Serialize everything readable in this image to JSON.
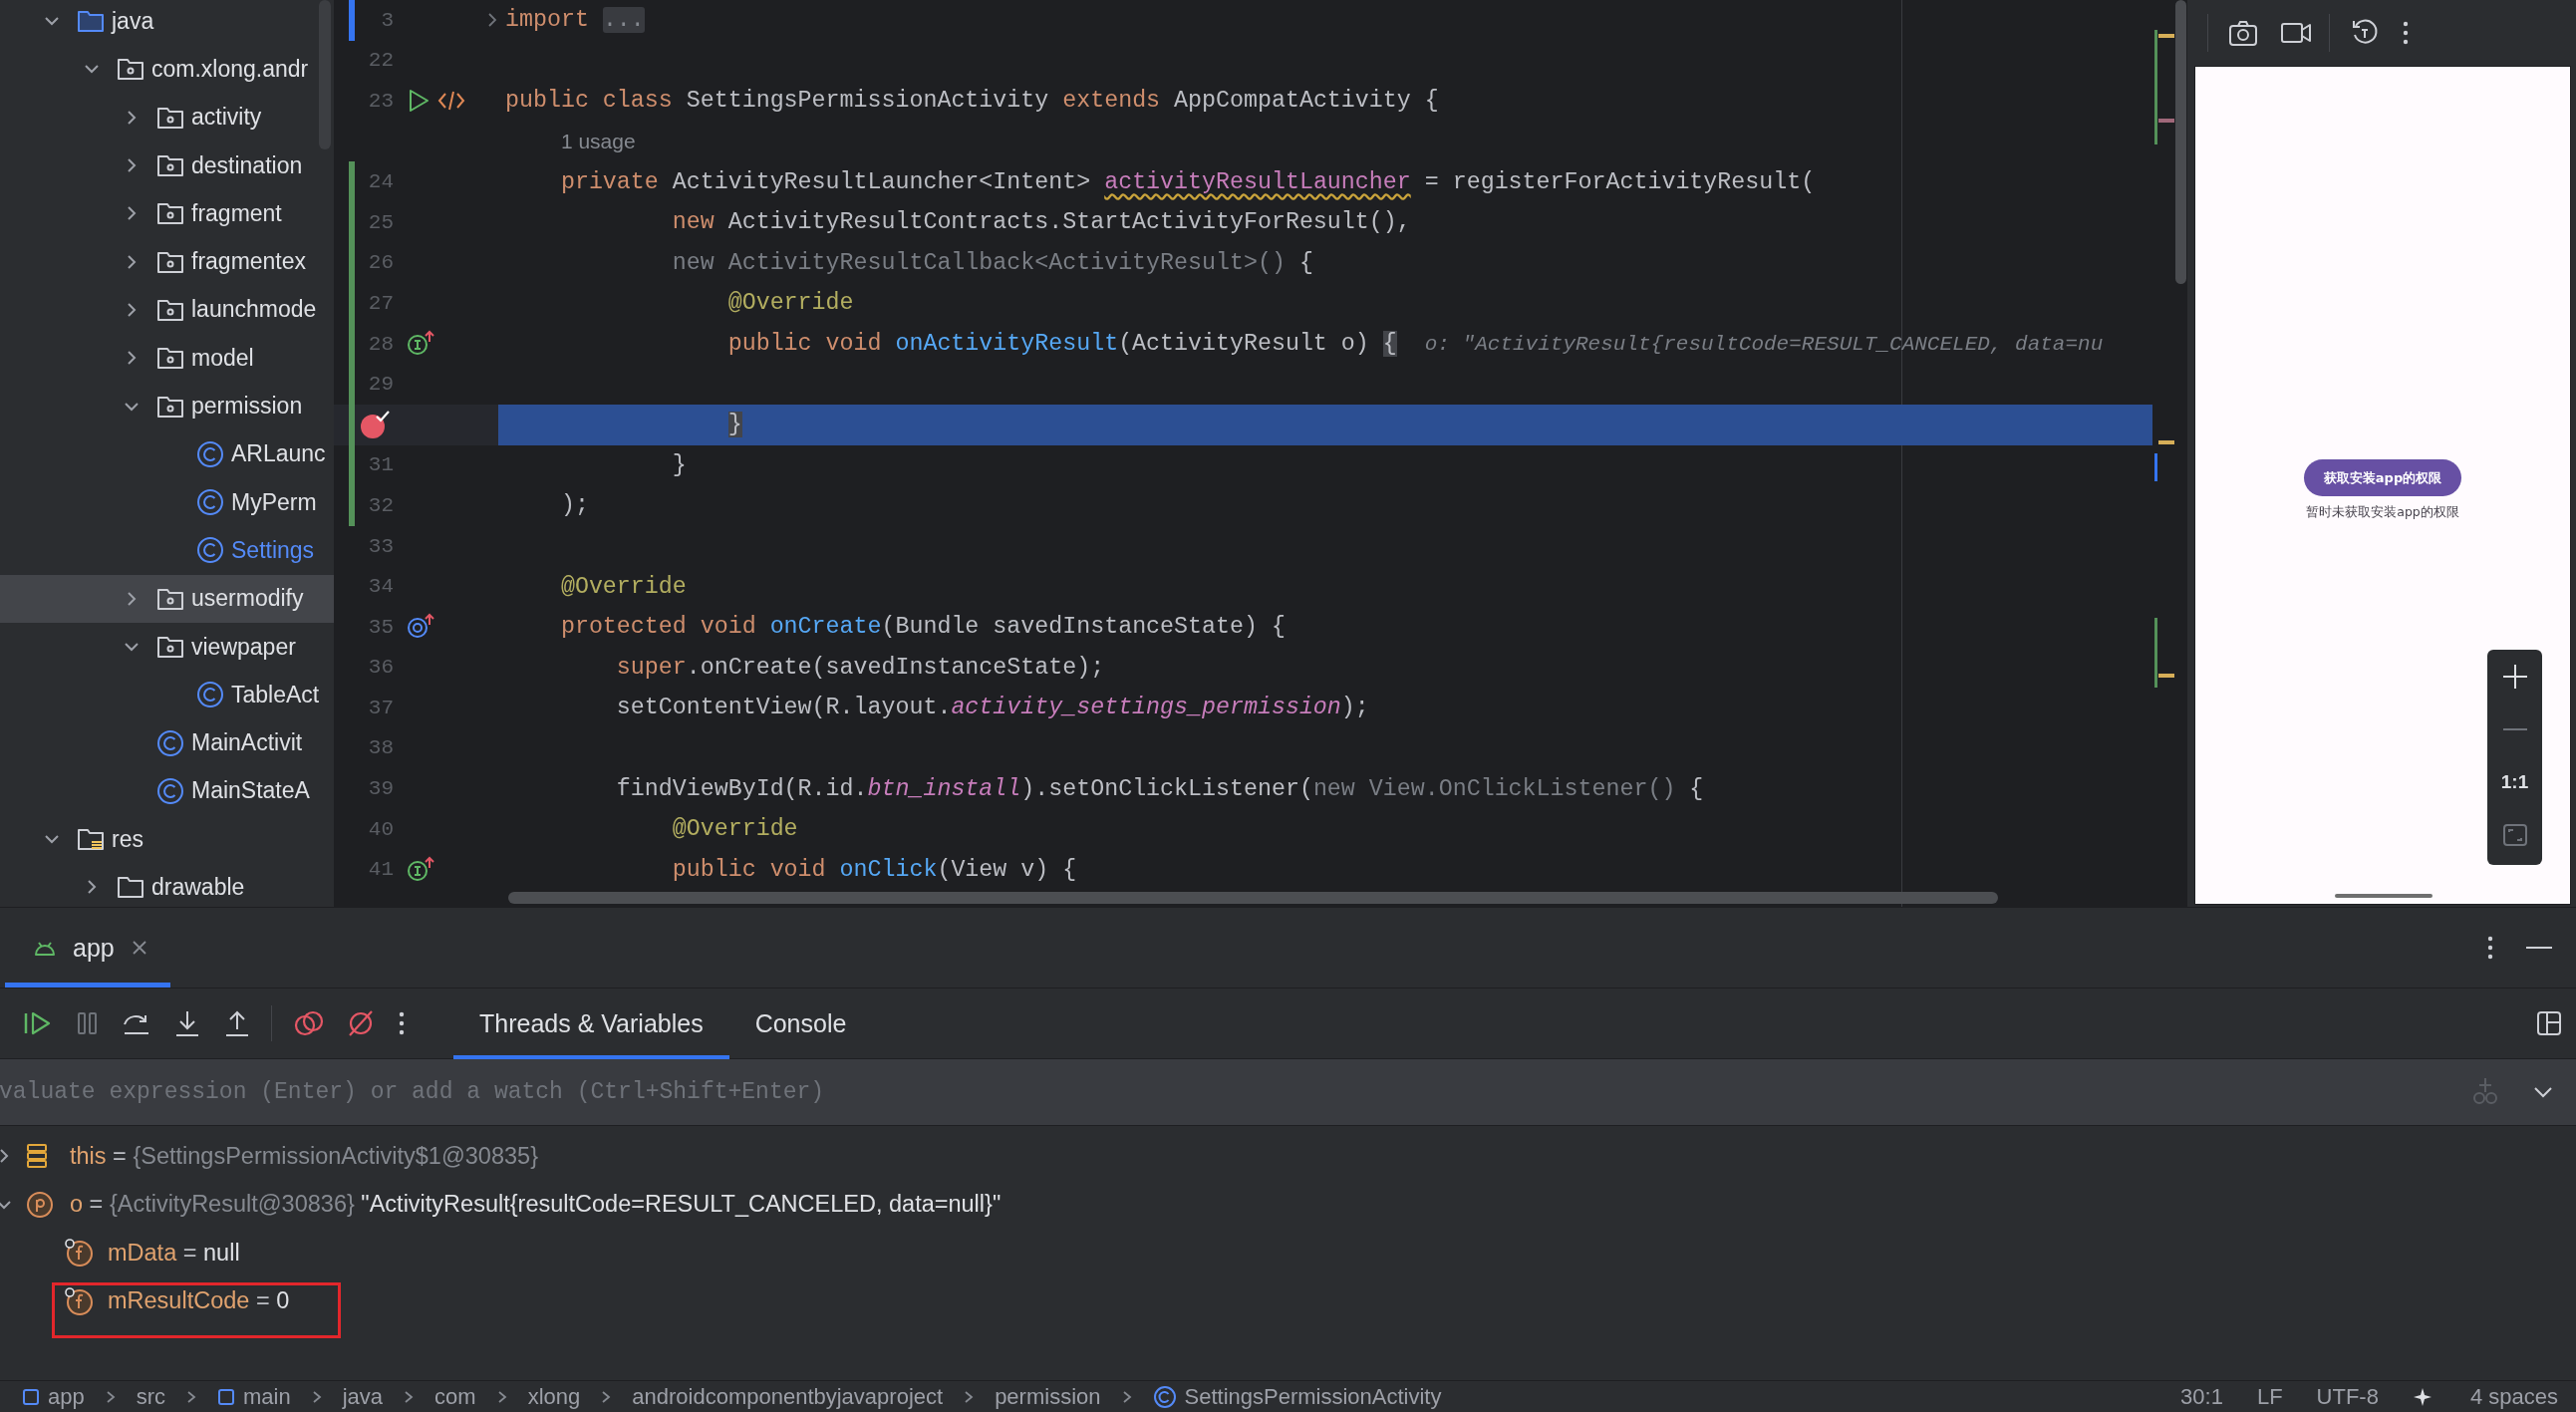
{
  "project_tree": {
    "items": [
      {
        "label": "java",
        "kind": "source_root",
        "expanded": true,
        "selected": false,
        "open": false,
        "children": [
          {
            "label": "com.xlong.andr",
            "kind": "package",
            "expanded": true,
            "selected": false,
            "open": false,
            "children": [
              {
                "label": "activity",
                "kind": "package",
                "expanded": false,
                "selected": false,
                "open": false
              },
              {
                "label": "destination",
                "kind": "package",
                "expanded": false,
                "selected": false,
                "open": false
              },
              {
                "label": "fragment",
                "kind": "package",
                "expanded": false,
                "selected": false,
                "open": false
              },
              {
                "label": "fragmentex",
                "kind": "package",
                "expanded": false,
                "selected": false,
                "open": false
              },
              {
                "label": "launchmode",
                "kind": "package",
                "expanded": false,
                "selected": false,
                "open": false
              },
              {
                "label": "model",
                "kind": "package",
                "expanded": false,
                "selected": false,
                "open": false
              },
              {
                "label": "permission",
                "kind": "package",
                "expanded": true,
                "selected": false,
                "open": false,
                "children": [
                  {
                    "label": "ARLaunc",
                    "kind": "class",
                    "selected": false,
                    "open": false
                  },
                  {
                    "label": "MyPerm",
                    "kind": "class",
                    "selected": false,
                    "open": false
                  },
                  {
                    "label": "Settings",
                    "kind": "class",
                    "selected": false,
                    "open": true
                  }
                ]
              },
              {
                "label": "usermodify",
                "kind": "package",
                "expanded": false,
                "selected": true,
                "open": false
              },
              {
                "label": "viewpaper",
                "kind": "package",
                "expanded": true,
                "selected": false,
                "open": false,
                "children": [
                  {
                    "label": "TableAct",
                    "kind": "class",
                    "selected": false,
                    "open": false
                  }
                ]
              },
              {
                "label": "MainActivit",
                "kind": "class",
                "selected": false,
                "open": false
              },
              {
                "label": "MainStateA",
                "kind": "class",
                "selected": false,
                "open": false
              }
            ]
          }
        ]
      },
      {
        "label": "res",
        "kind": "resource_root",
        "expanded": true,
        "selected": false,
        "open": false,
        "children": [
          {
            "label": "drawable",
            "kind": "folder",
            "expanded": false,
            "selected": false,
            "open": false
          }
        ]
      }
    ]
  },
  "editor": {
    "lines": [
      {
        "number": "3",
        "added": false,
        "modified": true,
        "current": false,
        "folded": true,
        "tokens": [
          {
            "kind": "keyword",
            "text": "import "
          },
          {
            "kind": "fold",
            "text": "..."
          }
        ]
      },
      {
        "number": "22",
        "added": false,
        "modified": false,
        "current": false
      },
      {
        "number": "23",
        "added": false,
        "modified": false,
        "current": false,
        "run": true,
        "layout": true,
        "tokens": [
          {
            "kind": "keyword",
            "text": "public class "
          },
          {
            "kind": "plain",
            "text": "SettingsPermissionActivity "
          },
          {
            "kind": "keyword",
            "text": "extends "
          },
          {
            "kind": "plain",
            "text": "AppCompatActivity {"
          }
        ]
      },
      {
        "added": false,
        "modified": false,
        "current": false,
        "tokens": [
          {
            "kind": "hint",
            "text": "    1 usage"
          }
        ]
      },
      {
        "number": "24",
        "added": true,
        "modified": false,
        "current": false,
        "tokens": [
          {
            "kind": "keyword",
            "text": "    private "
          },
          {
            "kind": "plain",
            "text": "ActivityResultLauncher<Intent> "
          },
          {
            "kind": "field_warn",
            "text": "activityResultLauncher"
          },
          {
            "kind": "plain",
            "text": " = registerForActivityResult("
          }
        ]
      },
      {
        "number": "25",
        "added": true,
        "modified": false,
        "current": false,
        "tokens": [
          {
            "kind": "keyword",
            "text": "            new "
          },
          {
            "kind": "plain",
            "text": "ActivityResultContracts.StartActivityForResult(),"
          }
        ]
      },
      {
        "number": "26",
        "added": true,
        "modified": false,
        "current": false,
        "tokens": [
          {
            "kind": "dim",
            "text": "            new ActivityResultCallback<ActivityResult>()"
          },
          {
            "kind": "plain",
            "text": " {"
          }
        ]
      },
      {
        "number": "27",
        "added": true,
        "modified": false,
        "current": false,
        "tokens": [
          {
            "kind": "annotation",
            "text": "                @Override"
          }
        ]
      },
      {
        "number": "28",
        "added": true,
        "modified": false,
        "current": false,
        "implements": true,
        "tokens": [
          {
            "kind": "keyword",
            "text": "                public void "
          },
          {
            "kind": "method",
            "text": "onActivityResult"
          },
          {
            "kind": "plain",
            "text": "(ActivityResult o) "
          },
          {
            "kind": "brace",
            "text": "{"
          }
        ],
        "inlay": "o: \"ActivityResult{resultCode=RESULT_CANCELED, data=nu"
      },
      {
        "number": "29",
        "added": true,
        "modified": false,
        "current": false
      },
      {
        "added": true,
        "modified": false,
        "current": true,
        "breakpoint": true,
        "tokens": [
          {
            "kind": "brace",
            "text": "                }"
          }
        ]
      },
      {
        "number": "31",
        "added": true,
        "modified": false,
        "current": false,
        "tokens": [
          {
            "kind": "plain",
            "text": "            }"
          }
        ]
      },
      {
        "number": "32",
        "added": true,
        "modified": false,
        "current": false,
        "tokens": [
          {
            "kind": "plain",
            "text": "    );"
          }
        ]
      },
      {
        "number": "33",
        "added": false,
        "modified": false,
        "current": false
      },
      {
        "number": "34",
        "added": false,
        "modified": false,
        "current": false,
        "tokens": [
          {
            "kind": "annotation",
            "text": "    @Override"
          }
        ]
      },
      {
        "number": "35",
        "added": false,
        "modified": false,
        "current": false,
        "overrides": true,
        "tokens": [
          {
            "kind": "keyword",
            "text": "    protected void "
          },
          {
            "kind": "method",
            "text": "onCreate"
          },
          {
            "kind": "plain",
            "text": "(Bundle savedInstanceState) {"
          }
        ]
      },
      {
        "number": "36",
        "added": false,
        "modified": false,
        "current": false,
        "tokens": [
          {
            "kind": "keyword",
            "text": "        super"
          },
          {
            "kind": "plain",
            "text": ".onCreate(savedInstanceState);"
          }
        ]
      },
      {
        "number": "37",
        "added": false,
        "modified": false,
        "current": false,
        "tokens": [
          {
            "kind": "plain",
            "text": "        setContentView(R.layout."
          },
          {
            "kind": "static",
            "text": "activity_settings_permission"
          },
          {
            "kind": "plain",
            "text": ");"
          }
        ]
      },
      {
        "number": "38",
        "added": false,
        "modified": false,
        "current": false
      },
      {
        "number": "39",
        "added": false,
        "modified": false,
        "current": false,
        "tokens": [
          {
            "kind": "plain",
            "text": "        findViewById(R.id."
          },
          {
            "kind": "static",
            "text": "btn_install"
          },
          {
            "kind": "plain",
            "text": ").setOnClickListener("
          },
          {
            "kind": "dim",
            "text": "new View.OnClickListener()"
          },
          {
            "kind": "plain",
            "text": " {"
          }
        ]
      },
      {
        "number": "40",
        "added": false,
        "modified": false,
        "current": false,
        "tokens": [
          {
            "kind": "annotation",
            "text": "            @Override"
          }
        ]
      },
      {
        "number": "41",
        "added": false,
        "modified": false,
        "current": false,
        "implements": true,
        "tokens": [
          {
            "kind": "keyword",
            "text": "            public void "
          },
          {
            "kind": "method",
            "text": "onClick"
          },
          {
            "kind": "plain",
            "text": "(View v) {"
          }
        ]
      }
    ]
  },
  "emulator": {
    "button": "获取安装app的权限",
    "status": "暂时未获取安装app的权限",
    "zoom_label": "1:1"
  },
  "debug": {
    "session_tab": {
      "label": "app",
      "selected": true
    },
    "tabs": [
      {
        "label": "Threads & Variables",
        "selected": true
      },
      {
        "label": "Console",
        "selected": false
      }
    ],
    "evaluate": {
      "placeholder": "valuate expression (Enter) or add a watch (Ctrl+Shift+Enter)"
    },
    "variables": [
      {
        "kind": "object",
        "name": "this",
        "operator": "=",
        "type_info": "{SettingsPermissionActivity$1@30835}",
        "expanded": false,
        "boxed": false
      },
      {
        "kind": "parameter",
        "name": "o",
        "operator": "=",
        "type_info": "{ActivityResult@30836}",
        "value": "\"ActivityResult{resultCode=RESULT_CANCELED, data=null}\"",
        "expanded": true,
        "boxed": false,
        "children": [
          {
            "kind": "field",
            "name": "mData",
            "operator": "=",
            "value": "null",
            "boxed": false
          },
          {
            "kind": "field",
            "name": "mResultCode",
            "operator": "=",
            "value": "0",
            "boxed": true
          }
        ]
      }
    ]
  },
  "status_bar": {
    "breadcrumbs": [
      {
        "label": "app",
        "kind": "module"
      },
      {
        "label": "src",
        "kind": "folder"
      },
      {
        "label": "main",
        "kind": "module"
      },
      {
        "label": "java",
        "kind": "folder"
      },
      {
        "label": "com",
        "kind": "folder"
      },
      {
        "label": "xlong",
        "kind": "folder"
      },
      {
        "label": "androidcomponentbyjavaproject",
        "kind": "folder"
      },
      {
        "label": "permission",
        "kind": "folder"
      },
      {
        "label": "SettingsPermissionActivity",
        "kind": "class"
      }
    ],
    "position": "30:1",
    "line_ending": "LF",
    "encoding": "UTF-8",
    "indent": "4 spaces"
  }
}
